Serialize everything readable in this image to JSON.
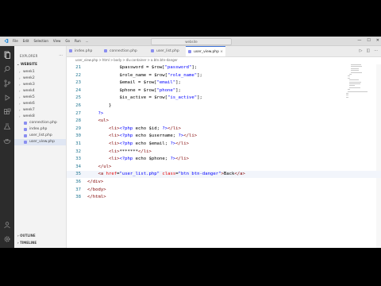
{
  "titlebar": {
    "menu": [
      "File",
      "Edit",
      "Selection",
      "View",
      "Go",
      "Run",
      "..."
    ],
    "command_center": "website",
    "controls": [
      "—",
      "☐",
      "✕"
    ]
  },
  "sidebar": {
    "title": "EXPLORER",
    "section": "WEBSITE",
    "items": [
      {
        "label": "week1",
        "kind": "folder"
      },
      {
        "label": "week2",
        "kind": "folder"
      },
      {
        "label": "week3",
        "kind": "folder"
      },
      {
        "label": "week4",
        "kind": "folder"
      },
      {
        "label": "week5",
        "kind": "folder"
      },
      {
        "label": "week6",
        "kind": "folder"
      },
      {
        "label": "week7",
        "kind": "folder"
      },
      {
        "label": "week8",
        "kind": "folder"
      },
      {
        "label": "connection.php",
        "kind": "file"
      },
      {
        "label": "index.php",
        "kind": "file"
      },
      {
        "label": "user_list.php",
        "kind": "file"
      },
      {
        "label": "user_view.php",
        "kind": "file",
        "active": true
      }
    ],
    "outline": "OUTLINE",
    "timeline": "TIMELINE"
  },
  "tabs": [
    {
      "label": "index.php"
    },
    {
      "label": "connection.php"
    },
    {
      "label": "user_list.php"
    },
    {
      "label": "user_view.php",
      "active": true
    }
  ],
  "breadcrumb": [
    "user_view.php",
    ">",
    "html",
    ">",
    "body",
    ">",
    "div.container",
    ">",
    "a.btn.btn-danger"
  ],
  "editor": {
    "lines": [
      {
        "n": "21",
        "text": "            $password = $row[\"password\"];"
      },
      {
        "n": "22",
        "text": "            $role_name = $row[\"role_name\"];"
      },
      {
        "n": "23",
        "text": "            $email = $row[\"email\"];"
      },
      {
        "n": "24",
        "text": "            $phone = $row[\"phone\"];"
      },
      {
        "n": "25",
        "text": "            $is_active = $row[\"is_active\"];"
      },
      {
        "n": "26",
        "text": "        }"
      },
      {
        "n": "27",
        "text": "    ?>"
      },
      {
        "n": "28",
        "text": "    <ul>"
      },
      {
        "n": "29",
        "text": "        <li><?php echo $id; ?></li>"
      },
      {
        "n": "30",
        "text": "        <li><?php echo $username; ?></li>"
      },
      {
        "n": "31",
        "text": "        <li><?php echo $email; ?></li>"
      },
      {
        "n": "32",
        "text": "        <li>*******</li>"
      },
      {
        "n": "33",
        "text": "        <li><?php echo $phone; ?></li>"
      },
      {
        "n": "34",
        "text": "    </ul>"
      },
      {
        "n": "35",
        "text": "    <a href=\"user_list.php\" class=\"btn btn-danger\">Back</a>"
      },
      {
        "n": "36",
        "text": "</div>"
      },
      {
        "n": "37",
        "text": "</body>"
      },
      {
        "n": "38",
        "text": "</html>"
      }
    ],
    "current_line": "35"
  },
  "colors": {
    "activity_bar": "#2c2c2c",
    "accent": "#3d73d8",
    "line_number": "#237893",
    "tag": "#800000",
    "attribute": "#e50000",
    "string": "#0000ff"
  }
}
